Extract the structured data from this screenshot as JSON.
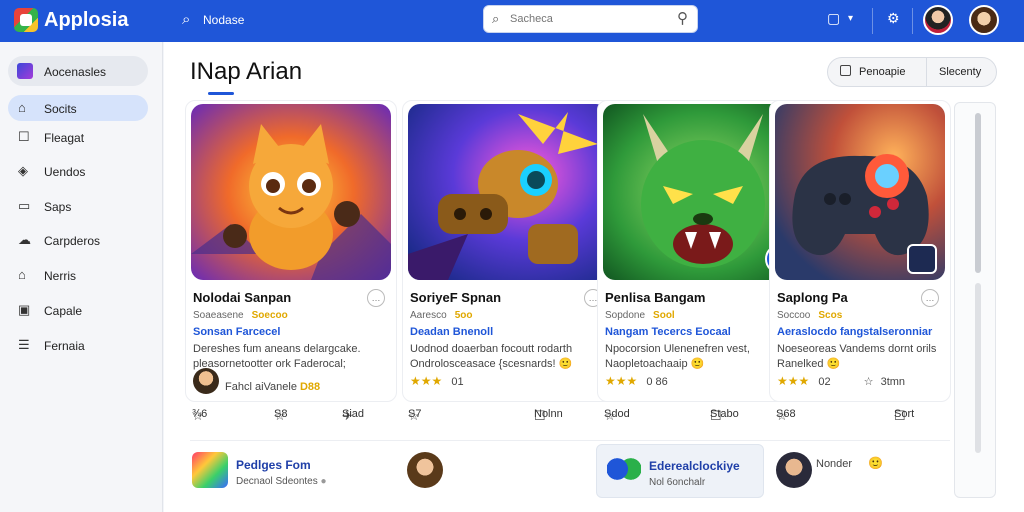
{
  "app": {
    "name": "Applosia"
  },
  "topbar": {
    "search_label": "Nodase",
    "search_placeholder": "Sacheca",
    "icons": [
      "search-icon",
      "bookmark-icon",
      "chevron-down-icon",
      "settings-icon",
      "avatar",
      "avatar"
    ]
  },
  "sidebar": {
    "header": "Aocenasles",
    "items": [
      {
        "label": "Socits",
        "icon": "home-icon",
        "active": true
      },
      {
        "label": "Fleagat",
        "icon": "square-icon",
        "active": false
      },
      {
        "label": "Uendos",
        "icon": "tag-icon",
        "active": false
      },
      {
        "label": "Saps",
        "icon": "folder-icon",
        "active": false
      },
      {
        "label": "Carpderos",
        "icon": "cloud-icon",
        "active": false
      },
      {
        "label": "Nerris",
        "icon": "home-alt-icon",
        "active": false
      },
      {
        "label": "Capale",
        "icon": "image-icon",
        "active": false
      },
      {
        "label": "Fernaia",
        "icon": "list-icon",
        "active": false
      }
    ]
  },
  "main": {
    "title": "INap  Arian",
    "toggle": {
      "option_a": "Penoapie",
      "option_b": "Slecenty"
    },
    "cards": [
      {
        "title": "Nolodai Sanpan",
        "subtitle": "Soaeasene",
        "subtitle_tag": "Soecoo",
        "category": "Sonsan Farcecel",
        "desc_line1": "Dereshes fum aneans delargcake.",
        "desc_line2": "pleasornetootter ork Faderocal;",
        "meta_name": "Fahcl aiVanele",
        "meta_badge": "D88",
        "actions": [
          "¾6",
          "S8",
          "Siad"
        ]
      },
      {
        "title": "SoriyeF Spnan",
        "subtitle": "Aaresco",
        "subtitle_tag": "5oo",
        "category": "Deadan Bnenoll",
        "desc_line1": "Uodnod doaerban focoutt rodarth",
        "desc_line2": "Ondrolosceasace {scesnards! 🙂",
        "meta_rating": "★★★",
        "meta_value": "01",
        "actions": [
          "S7",
          "Nolnn"
        ]
      },
      {
        "title": "Penlisa Bangam",
        "subtitle": "Sopdone",
        "subtitle_tag": "Sool",
        "category": "Nangam Tecercs Eocaal",
        "desc_line1": "Npocorsion Ulenenefren vest,",
        "desc_line2": "Naopletoachaaip 🙂",
        "meta_rating": "★★★",
        "meta_value": "0 86",
        "actions": [
          "Sdod",
          "Stabo"
        ]
      },
      {
        "title": "Saplong Pa",
        "subtitle": "Soccoo",
        "subtitle_tag": "Scos",
        "category": "Aeraslocdo fangstalseronniar",
        "desc_line1": "Noeseoreas Vandems dornt orils",
        "desc_line2": "Ranelked 🙂",
        "meta_rating": "★★★",
        "meta_value": "02",
        "meta_extra": "3tmn",
        "actions": [
          "S68",
          "Sort"
        ]
      }
    ],
    "list": [
      {
        "title": "Pedlges Fom",
        "subtitle": "Decnaol Sdeontes"
      },
      {
        "title": "",
        "subtitle": ""
      },
      {
        "title": "Ederealclockiye",
        "subtitle": "Nol 6onchalr"
      },
      {
        "title": "Nonder",
        "subtitle": ""
      }
    ]
  },
  "colors": {
    "brand": "#1f56d8",
    "accent_yellow": "#e0a800",
    "sidebar_active": "#d6e3fb"
  }
}
